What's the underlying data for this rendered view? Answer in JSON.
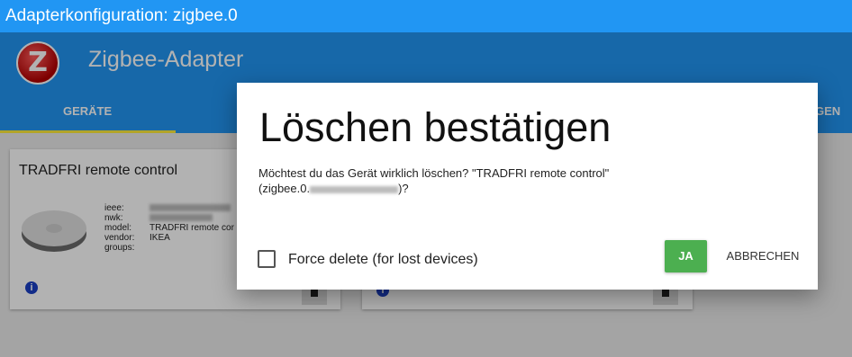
{
  "window": {
    "title": "Adapterkonfiguration: zigbee.0"
  },
  "app": {
    "logo_letter": "Z",
    "title": "Zigbee-Adapter",
    "tabs": [
      {
        "label": "GERÄTE"
      },
      {
        "label": "GEN"
      }
    ],
    "tab_indicator_color": "#ffeb3b",
    "accent_color": "#2196f3"
  },
  "device_card": {
    "title": "TRADFRI remote control",
    "properties": [
      {
        "label": "ieee:",
        "value": ""
      },
      {
        "label": "nwk:",
        "value": ""
      },
      {
        "label": "model:",
        "value": "TRADFRI remote cor"
      },
      {
        "label": "vendor:",
        "value": "IKEA"
      },
      {
        "label": "groups:",
        "value": ""
      }
    ],
    "info_icon": "info-icon",
    "delete_icon": "trash-icon"
  },
  "dialog": {
    "title": "Löschen bestätigen",
    "message_line1": "Möchtest du das Gerät wirklich löschen? \"TRADFRI remote control\"",
    "message_prefix": "(zigbee.0.",
    "message_suffix": ")?",
    "force_delete_label": "Force delete (for lost devices)",
    "force_delete_checked": false,
    "yes_label": "JA",
    "cancel_label": "ABBRECHEN",
    "yes_color": "#4caf50"
  }
}
